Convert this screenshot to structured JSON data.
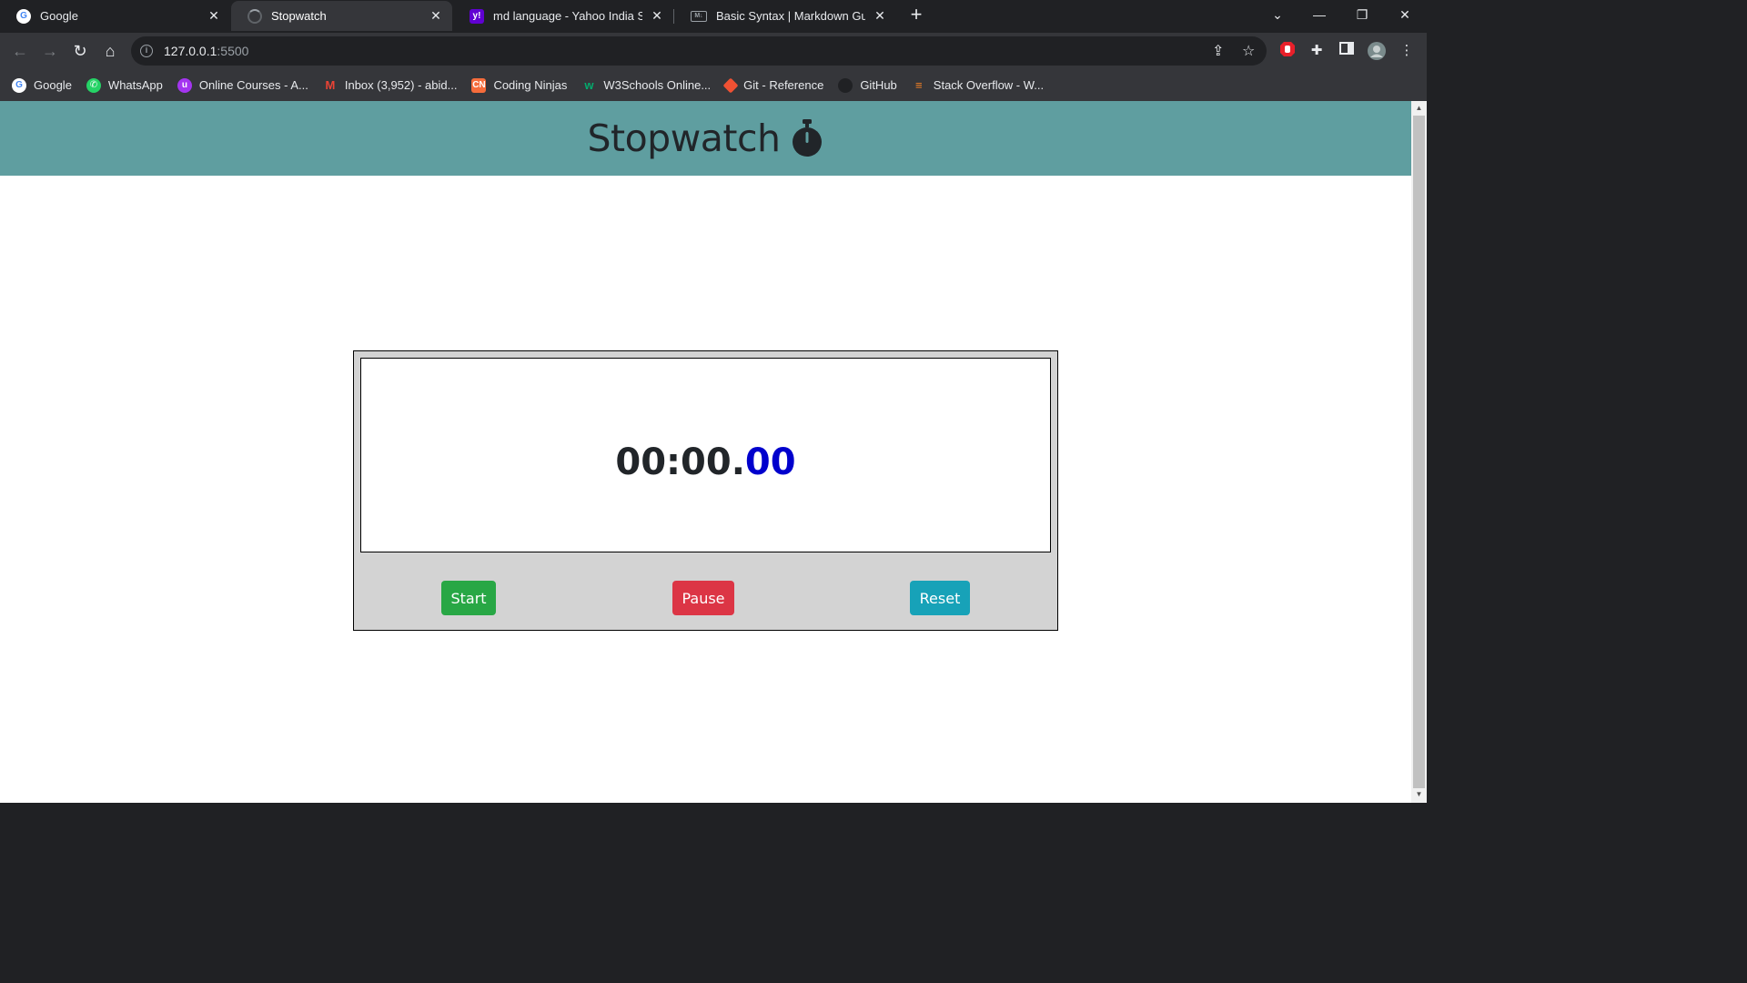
{
  "tabs": [
    {
      "title": "Google",
      "favicon": "google-icon",
      "active": false
    },
    {
      "title": "Stopwatch",
      "favicon": "loading-icon",
      "active": true
    },
    {
      "title": "md language - Yahoo India Searc",
      "favicon": "yahoo-icon",
      "active": false
    },
    {
      "title": "Basic Syntax | Markdown Guide",
      "favicon": "markdown-icon",
      "active": false
    }
  ],
  "address": {
    "host": "127.0.0.1",
    "port": ":5500"
  },
  "bookmarks": [
    {
      "label": "Google",
      "icon": "google-icon",
      "color": "#ffffff"
    },
    {
      "label": "WhatsApp",
      "icon": "whatsapp-icon",
      "color": "#25d366"
    },
    {
      "label": "Online Courses - A...",
      "icon": "udemy-icon",
      "color": "#a435f0"
    },
    {
      "label": "Inbox (3,952) - abid...",
      "icon": "gmail-icon",
      "color": "#ea4335"
    },
    {
      "label": "Coding Ninjas",
      "icon": "coding-ninjas-icon",
      "color": "#f66c3b"
    },
    {
      "label": "W3Schools Online...",
      "icon": "w3schools-icon",
      "color": "#04aa6d"
    },
    {
      "label": "Git - Reference",
      "icon": "git-icon",
      "color": "#f05133"
    },
    {
      "label": "GitHub",
      "icon": "github-icon",
      "color": "#202124"
    },
    {
      "label": "Stack Overflow - W...",
      "icon": "stackoverflow-icon",
      "color": "#f48024"
    }
  ],
  "page": {
    "title": "Stopwatch",
    "header_color": "#5f9ea0",
    "time_main": "00:00.",
    "time_ms": "00",
    "buttons": {
      "start": "Start",
      "pause": "Pause",
      "reset": "Reset"
    },
    "colors": {
      "start": "#28a745",
      "pause": "#dc3545",
      "reset": "#17a2b8",
      "ms": "#0000cd"
    }
  }
}
